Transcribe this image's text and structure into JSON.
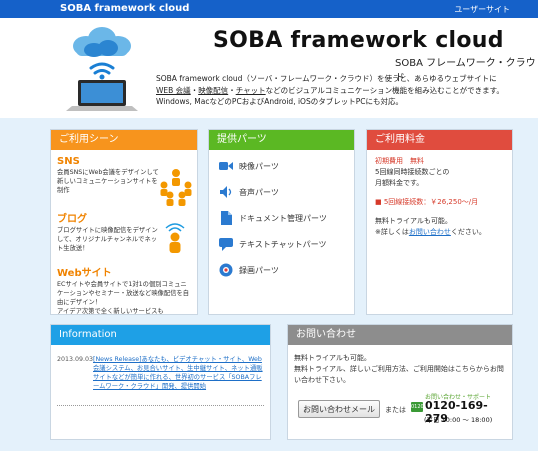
{
  "topbar": {
    "brand": "SOBA framework cloud",
    "user_site": "ユーザーサイト"
  },
  "hero": {
    "title": "SOBA framework cloud",
    "subtitle": "SOBA フレームワーク・クラウド",
    "desc_line1": "SOBA framework cloud（ソーバ・フレームワーク・クラウド）を使うと、あらゆるウェブサイトに",
    "link_web_meeting": "WEB 会議",
    "sep1": "・",
    "link_video_delivery": "映像配信",
    "sep2": "・",
    "link_chat": "チャット",
    "desc_line2_rest": "などのビジュアルコミュニケーション機能を組み込むことができます。",
    "desc_line3": "Windows, MacなどのPCおよびAndroid, iOSのタブレットPCにも対応。"
  },
  "usecases": {
    "heading": "ご利用シーン",
    "items": [
      {
        "title": "SNS",
        "text": "会員SNSにWeb会議をデザインして\n新しいコミュニケーションサイトを\n制作"
      },
      {
        "title": "ブログ",
        "text": "ブログサイトに映像配信をデザイン\nして、オリジナルチャンネルでネッ\nト生放送！"
      },
      {
        "title": "Webサイト",
        "text": "ECサイトや会員サイトで1対1の個別コミュニ\nケーションやセミナー・放送など映像配信を自\n由にデザイン！\nアイデア次第で全く新しいサービスも"
      }
    ]
  },
  "features": {
    "heading": "提供パーツ",
    "items": [
      {
        "label": "映像パーツ",
        "icon": "video-icon"
      },
      {
        "label": "音声パーツ",
        "icon": "speaker-icon"
      },
      {
        "label": "ドキュメント管理パーツ",
        "icon": "document-icon"
      },
      {
        "label": "テキストチャットパーツ",
        "icon": "chat-icon"
      },
      {
        "label": "録画パーツ",
        "icon": "record-icon"
      }
    ]
  },
  "pricing": {
    "heading": "ご利用料金",
    "initial_label": "初期費用　無料",
    "line1": "5回線同時接続数ごとの",
    "line2": "月額料金です。",
    "price": "■ 5回線接続数：￥26,250〜/月",
    "trial": "無料トライアルも可能。",
    "detail_prefix": "※詳しくは",
    "detail_link": "お問い合わせ",
    "detail_suffix": "ください。"
  },
  "info": {
    "heading": "Information",
    "date": "2013.09.03",
    "text": "[News Release]あなたも、ビデオチャット・サイト、Web会議システム、お見合いサイト、生中継サイト、ネット通販サイトなどが簡単に作れる、世界初のサービス「SOBAフレームワーク・クラウド」開発、提供開始"
  },
  "contact": {
    "heading": "お問い合わせ",
    "text1": "無料トライアルも可能。",
    "text2": "無料トライアル、詳しいご利用方法、ご利用開始はこちらからお問い合わせ下さい。",
    "button": "お問い合わせメール",
    "or": "または",
    "phone_label": "お問い合わせ・サポート",
    "phone_badge": "0120",
    "phone": "0120-169-279",
    "hours": "(平日 10:00 〜 18:00)"
  },
  "colors": {
    "topbar": "#1561c9",
    "background": "#e4f1fb",
    "usecases": "#f7941d",
    "features": "#5bb823",
    "pricing": "#e04c3e",
    "info": "#1ea0e6",
    "contact": "#8d8d8d"
  }
}
